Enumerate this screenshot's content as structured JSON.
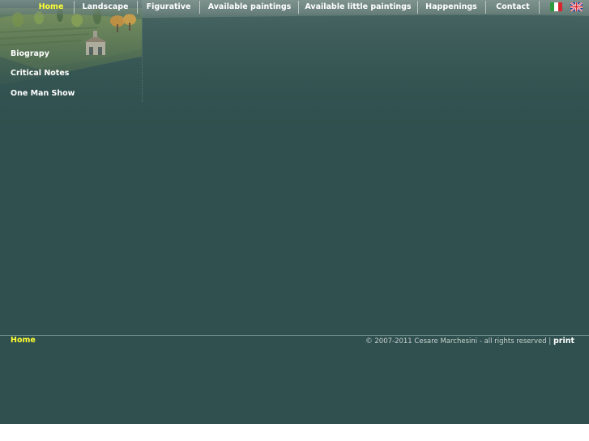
{
  "nav": {
    "items": [
      {
        "label": "Home",
        "active": true
      },
      {
        "label": "Landscape",
        "active": false
      },
      {
        "label": "Figurative",
        "active": false
      },
      {
        "label": "Available paintings",
        "active": false
      },
      {
        "label": "Available little paintings",
        "active": false
      },
      {
        "label": "Happenings",
        "active": false
      },
      {
        "label": "Contact",
        "active": false
      }
    ],
    "languages": [
      "italian-flag-icon",
      "english-flag-icon"
    ],
    "active_color": "#ffff33"
  },
  "sidebar": {
    "items": [
      {
        "label": "Biograpy"
      },
      {
        "label": "Critical Notes"
      },
      {
        "label": "One Man Show"
      }
    ]
  },
  "footer": {
    "breadcrumb": "Home",
    "copyright": "© 2007-2011 Cesare Marchesini - all rights reserved |",
    "print_label": "print"
  },
  "colors": {
    "background": "#2f504e",
    "footer_text": "#c8d2d0"
  }
}
